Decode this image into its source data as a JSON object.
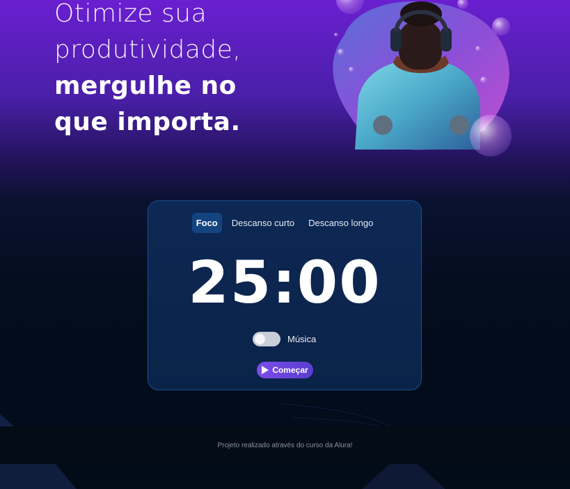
{
  "hero": {
    "line1": "Otimize sua",
    "line2": "produtividade,",
    "line3": "mergulhe no",
    "line4": "que importa."
  },
  "timer": {
    "tabs": [
      {
        "label": "Foco",
        "active": true
      },
      {
        "label": "Descanso curto",
        "active": false
      },
      {
        "label": "Descanso longo",
        "active": false
      }
    ],
    "time": "25:00",
    "music_label": "Música",
    "music_on": false,
    "start_label": "Começar"
  },
  "footer": {
    "text": "Projeto realizado através do curso da Alura!"
  },
  "colors": {
    "accent": "#7c4de9",
    "active_tab": "#144480",
    "card_bg": "#0d2854",
    "card_border": "#1d4a8a"
  },
  "icons": {
    "start": "play-icon",
    "toggle": "toggle-switch"
  }
}
